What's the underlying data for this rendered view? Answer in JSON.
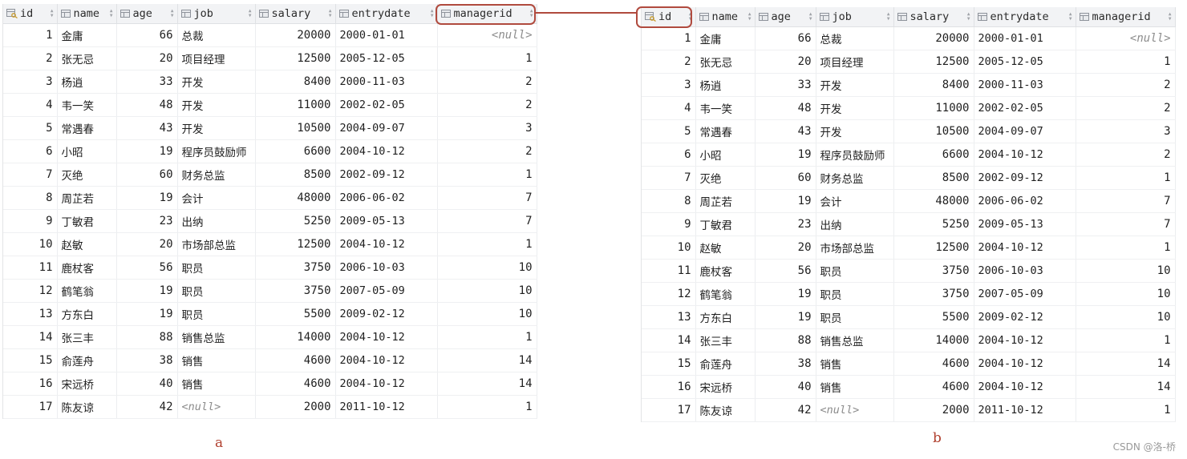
{
  "columns": [
    "id",
    "name",
    "age",
    "job",
    "salary",
    "entrydate",
    "managerid"
  ],
  "rows": [
    [
      "1",
      "金庸",
      "66",
      "总裁",
      "20000",
      "2000-01-01",
      "<null>"
    ],
    [
      "2",
      "张无忌",
      "20",
      "项目经理",
      "12500",
      "2005-12-05",
      "1"
    ],
    [
      "3",
      "杨逍",
      "33",
      "开发",
      "8400",
      "2000-11-03",
      "2"
    ],
    [
      "4",
      "韦一笑",
      "48",
      "开发",
      "11000",
      "2002-02-05",
      "2"
    ],
    [
      "5",
      "常遇春",
      "43",
      "开发",
      "10500",
      "2004-09-07",
      "3"
    ],
    [
      "6",
      "小昭",
      "19",
      "程序员鼓励师",
      "6600",
      "2004-10-12",
      "2"
    ],
    [
      "7",
      "灭绝",
      "60",
      "财务总监",
      "8500",
      "2002-09-12",
      "1"
    ],
    [
      "8",
      "周芷若",
      "19",
      "会计",
      "48000",
      "2006-06-02",
      "7"
    ],
    [
      "9",
      "丁敏君",
      "23",
      "出纳",
      "5250",
      "2009-05-13",
      "7"
    ],
    [
      "10",
      "赵敏",
      "20",
      "市场部总监",
      "12500",
      "2004-10-12",
      "1"
    ],
    [
      "11",
      "鹿杖客",
      "56",
      "职员",
      "3750",
      "2006-10-03",
      "10"
    ],
    [
      "12",
      "鹤笔翁",
      "19",
      "职员",
      "3750",
      "2007-05-09",
      "10"
    ],
    [
      "13",
      "方东白",
      "19",
      "职员",
      "5500",
      "2009-02-12",
      "10"
    ],
    [
      "14",
      "张三丰",
      "88",
      "销售总监",
      "14000",
      "2004-10-12",
      "1"
    ],
    [
      "15",
      "俞莲舟",
      "38",
      "销售",
      "4600",
      "2004-10-12",
      "14"
    ],
    [
      "16",
      "宋远桥",
      "40",
      "销售",
      "4600",
      "2004-10-12",
      "14"
    ],
    [
      "17",
      "陈友谅",
      "42",
      "<null>",
      "2000",
      "2011-10-12",
      "1"
    ]
  ],
  "captions": {
    "a": "a",
    "b": "b"
  },
  "watermark": "CSDN @洛-桥",
  "colors": {
    "highlight": "#b04a3e",
    "header_bg": "#f2f3f5",
    "null_text": "#8c8c8c"
  },
  "icons": {
    "primary_key_column": "key-column-icon",
    "column": "column-icon",
    "sort": "sort-icon"
  }
}
